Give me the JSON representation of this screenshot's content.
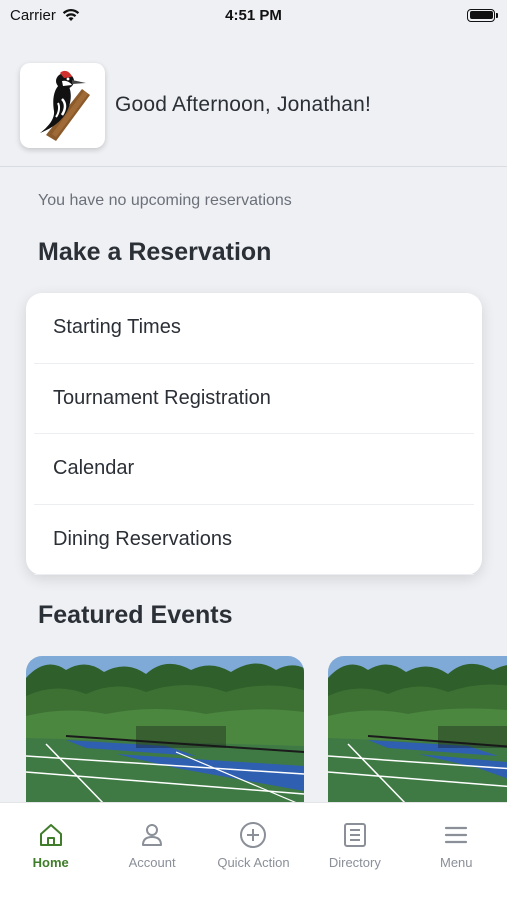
{
  "status_bar": {
    "carrier": "Carrier",
    "time": "4:51 PM"
  },
  "header": {
    "logo_icon": "woodpecker-logo",
    "greeting": "Good Afternoon, Jonathan!"
  },
  "reservations": {
    "empty_message": "You have no upcoming reservations"
  },
  "make_reservation": {
    "title": "Make a Reservation",
    "items": [
      {
        "label": "Starting Times"
      },
      {
        "label": "Tournament Registration"
      },
      {
        "label": "Calendar"
      },
      {
        "label": "Dining Reservations"
      }
    ]
  },
  "featured_events": {
    "title": "Featured Events",
    "cards": [
      {
        "image": "pickleball-courts-photo"
      },
      {
        "image": "pickleball-courts-photo"
      }
    ]
  },
  "tab_bar": {
    "active_color": "#3f7d2a",
    "inactive_color": "#8a8f98",
    "tabs": [
      {
        "label": "Home",
        "icon": "home-icon",
        "active": true
      },
      {
        "label": "Account",
        "icon": "person-icon",
        "active": false
      },
      {
        "label": "Quick Action",
        "icon": "plus-circle-icon",
        "active": false
      },
      {
        "label": "Directory",
        "icon": "list-icon",
        "active": false
      },
      {
        "label": "Menu",
        "icon": "hamburger-icon",
        "active": false
      }
    ]
  }
}
